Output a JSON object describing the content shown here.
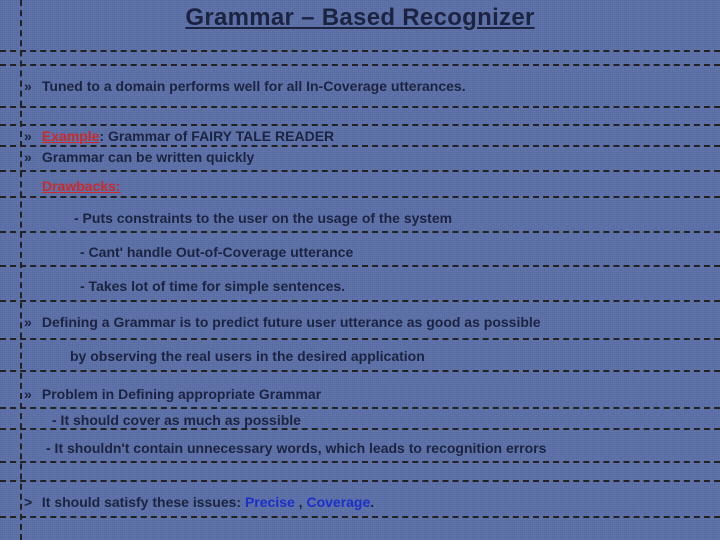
{
  "title": "Grammar – Based Recognizer",
  "bullet_glyph": "»",
  "lines": {
    "l1": "Tuned to a domain performs well for all In-Coverage  utterances.",
    "l2a": "Example",
    "l2b": ": Grammar of FAIRY TALE READER",
    "l3": "Grammar can be written quickly",
    "l4": "Drawbacks:",
    "l5": "- Puts constraints to the user on the usage of the system",
    "l6": "- Cant' handle Out-of-Coverage utterance",
    "l7": "- Takes lot of time for simple sentences.",
    "l8": "Defining a Grammar  is to predict  future user utterance as good as possible",
    "l8b": "by observing the real users in the desired application",
    "l9": "Problem in Defining appropriate Grammar",
    "l10": "- It should cover as much as possible",
    "l11": "- It shouldn't contain unnecessary words, which leads to recognition errors",
    "l12a": "It should satisfy these issues: ",
    "l12b": "Precise",
    "l12c": " , ",
    "l12d": "Coverage",
    "l12e": ".",
    "gt": ">"
  },
  "hr_positions": [
    50,
    64,
    106,
    124,
    145,
    170,
    196,
    231,
    265,
    300,
    338,
    370,
    407,
    428,
    461,
    480,
    516
  ]
}
